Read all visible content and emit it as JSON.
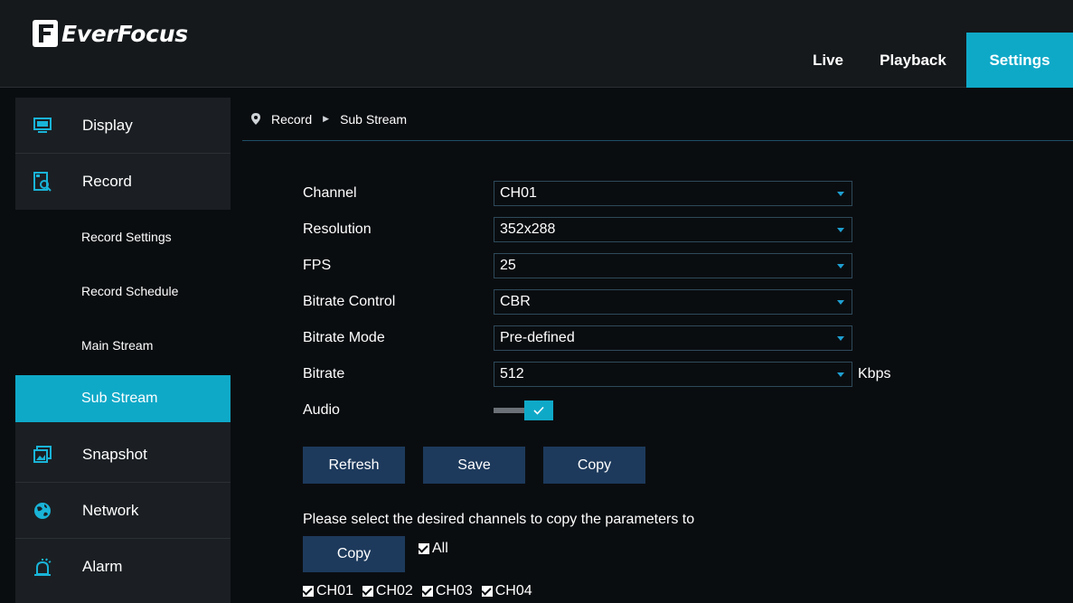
{
  "header": {
    "logo_text": "EverFocus",
    "tabs": [
      {
        "label": "Live"
      },
      {
        "label": "Playback"
      },
      {
        "label": "Settings",
        "active": true
      }
    ]
  },
  "sidebar": {
    "items": [
      {
        "label": "Display",
        "icon": "monitor-icon"
      },
      {
        "label": "Record",
        "icon": "record-search-icon",
        "expanded": true
      }
    ],
    "sub_items": [
      {
        "label": "Record Settings"
      },
      {
        "label": "Record Schedule"
      },
      {
        "label": "Main Stream"
      },
      {
        "label": "Sub Stream",
        "active": true
      }
    ],
    "items_after": [
      {
        "label": "Snapshot",
        "icon": "image-icon"
      },
      {
        "label": "Network",
        "icon": "globe-icon"
      },
      {
        "label": "Alarm",
        "icon": "alarm-bell-icon"
      }
    ]
  },
  "breadcrumb": {
    "parent": "Record",
    "current": "Sub Stream"
  },
  "form": {
    "channel": {
      "label": "Channel",
      "value": "CH01"
    },
    "resolution": {
      "label": "Resolution",
      "value": "352x288"
    },
    "fps": {
      "label": "FPS",
      "value": "25"
    },
    "bitrate_control": {
      "label": "Bitrate Control",
      "value": "CBR"
    },
    "bitrate_mode": {
      "label": "Bitrate Mode",
      "value": "Pre-defined"
    },
    "bitrate": {
      "label": "Bitrate",
      "value": "512",
      "unit": "Kbps"
    },
    "audio": {
      "label": "Audio",
      "enabled": true
    }
  },
  "buttons": {
    "refresh": "Refresh",
    "save": "Save",
    "copy": "Copy"
  },
  "copy_section": {
    "hint": "Please select the desired channels to copy the parameters to",
    "copy_button": "Copy",
    "all_label": "All",
    "channels": [
      "CH01",
      "CH02",
      "CH03",
      "CH04"
    ]
  },
  "colors": {
    "accent": "#0fa9c8",
    "button": "#1d3a5c",
    "background": "#0a0d10",
    "sidebar": "#1b1f23"
  }
}
